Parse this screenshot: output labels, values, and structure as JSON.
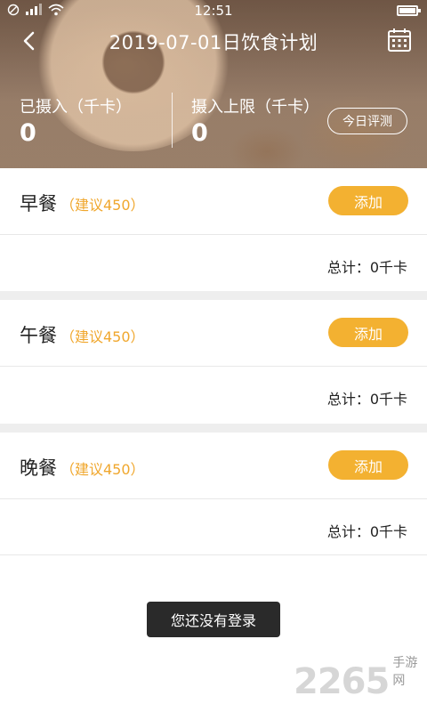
{
  "status_bar": {
    "time": "12:51"
  },
  "nav": {
    "title": "2019-07-01日饮食计划"
  },
  "stats": {
    "consumed_label": "已摄入（千卡）",
    "consumed_value": "0",
    "limit_label": "摄入上限（千卡）",
    "limit_value": "0",
    "evaluate_label": "今日评测"
  },
  "meals": [
    {
      "name": "早餐",
      "suggest": "（建议450）",
      "add_label": "添加",
      "total": "总计：0千卡"
    },
    {
      "name": "午餐",
      "suggest": "（建议450）",
      "add_label": "添加",
      "total": "总计：0千卡"
    },
    {
      "name": "晚餐",
      "suggest": "（建议450）",
      "add_label": "添加",
      "total": "总计：0千卡"
    }
  ],
  "toast": "您还没有登录",
  "watermark": {
    "number": "2265",
    "text": "手游网"
  },
  "colors": {
    "accent": "#f3b131",
    "suggest": "#f0a72d",
    "toast_bg": "#2a2a2a"
  }
}
